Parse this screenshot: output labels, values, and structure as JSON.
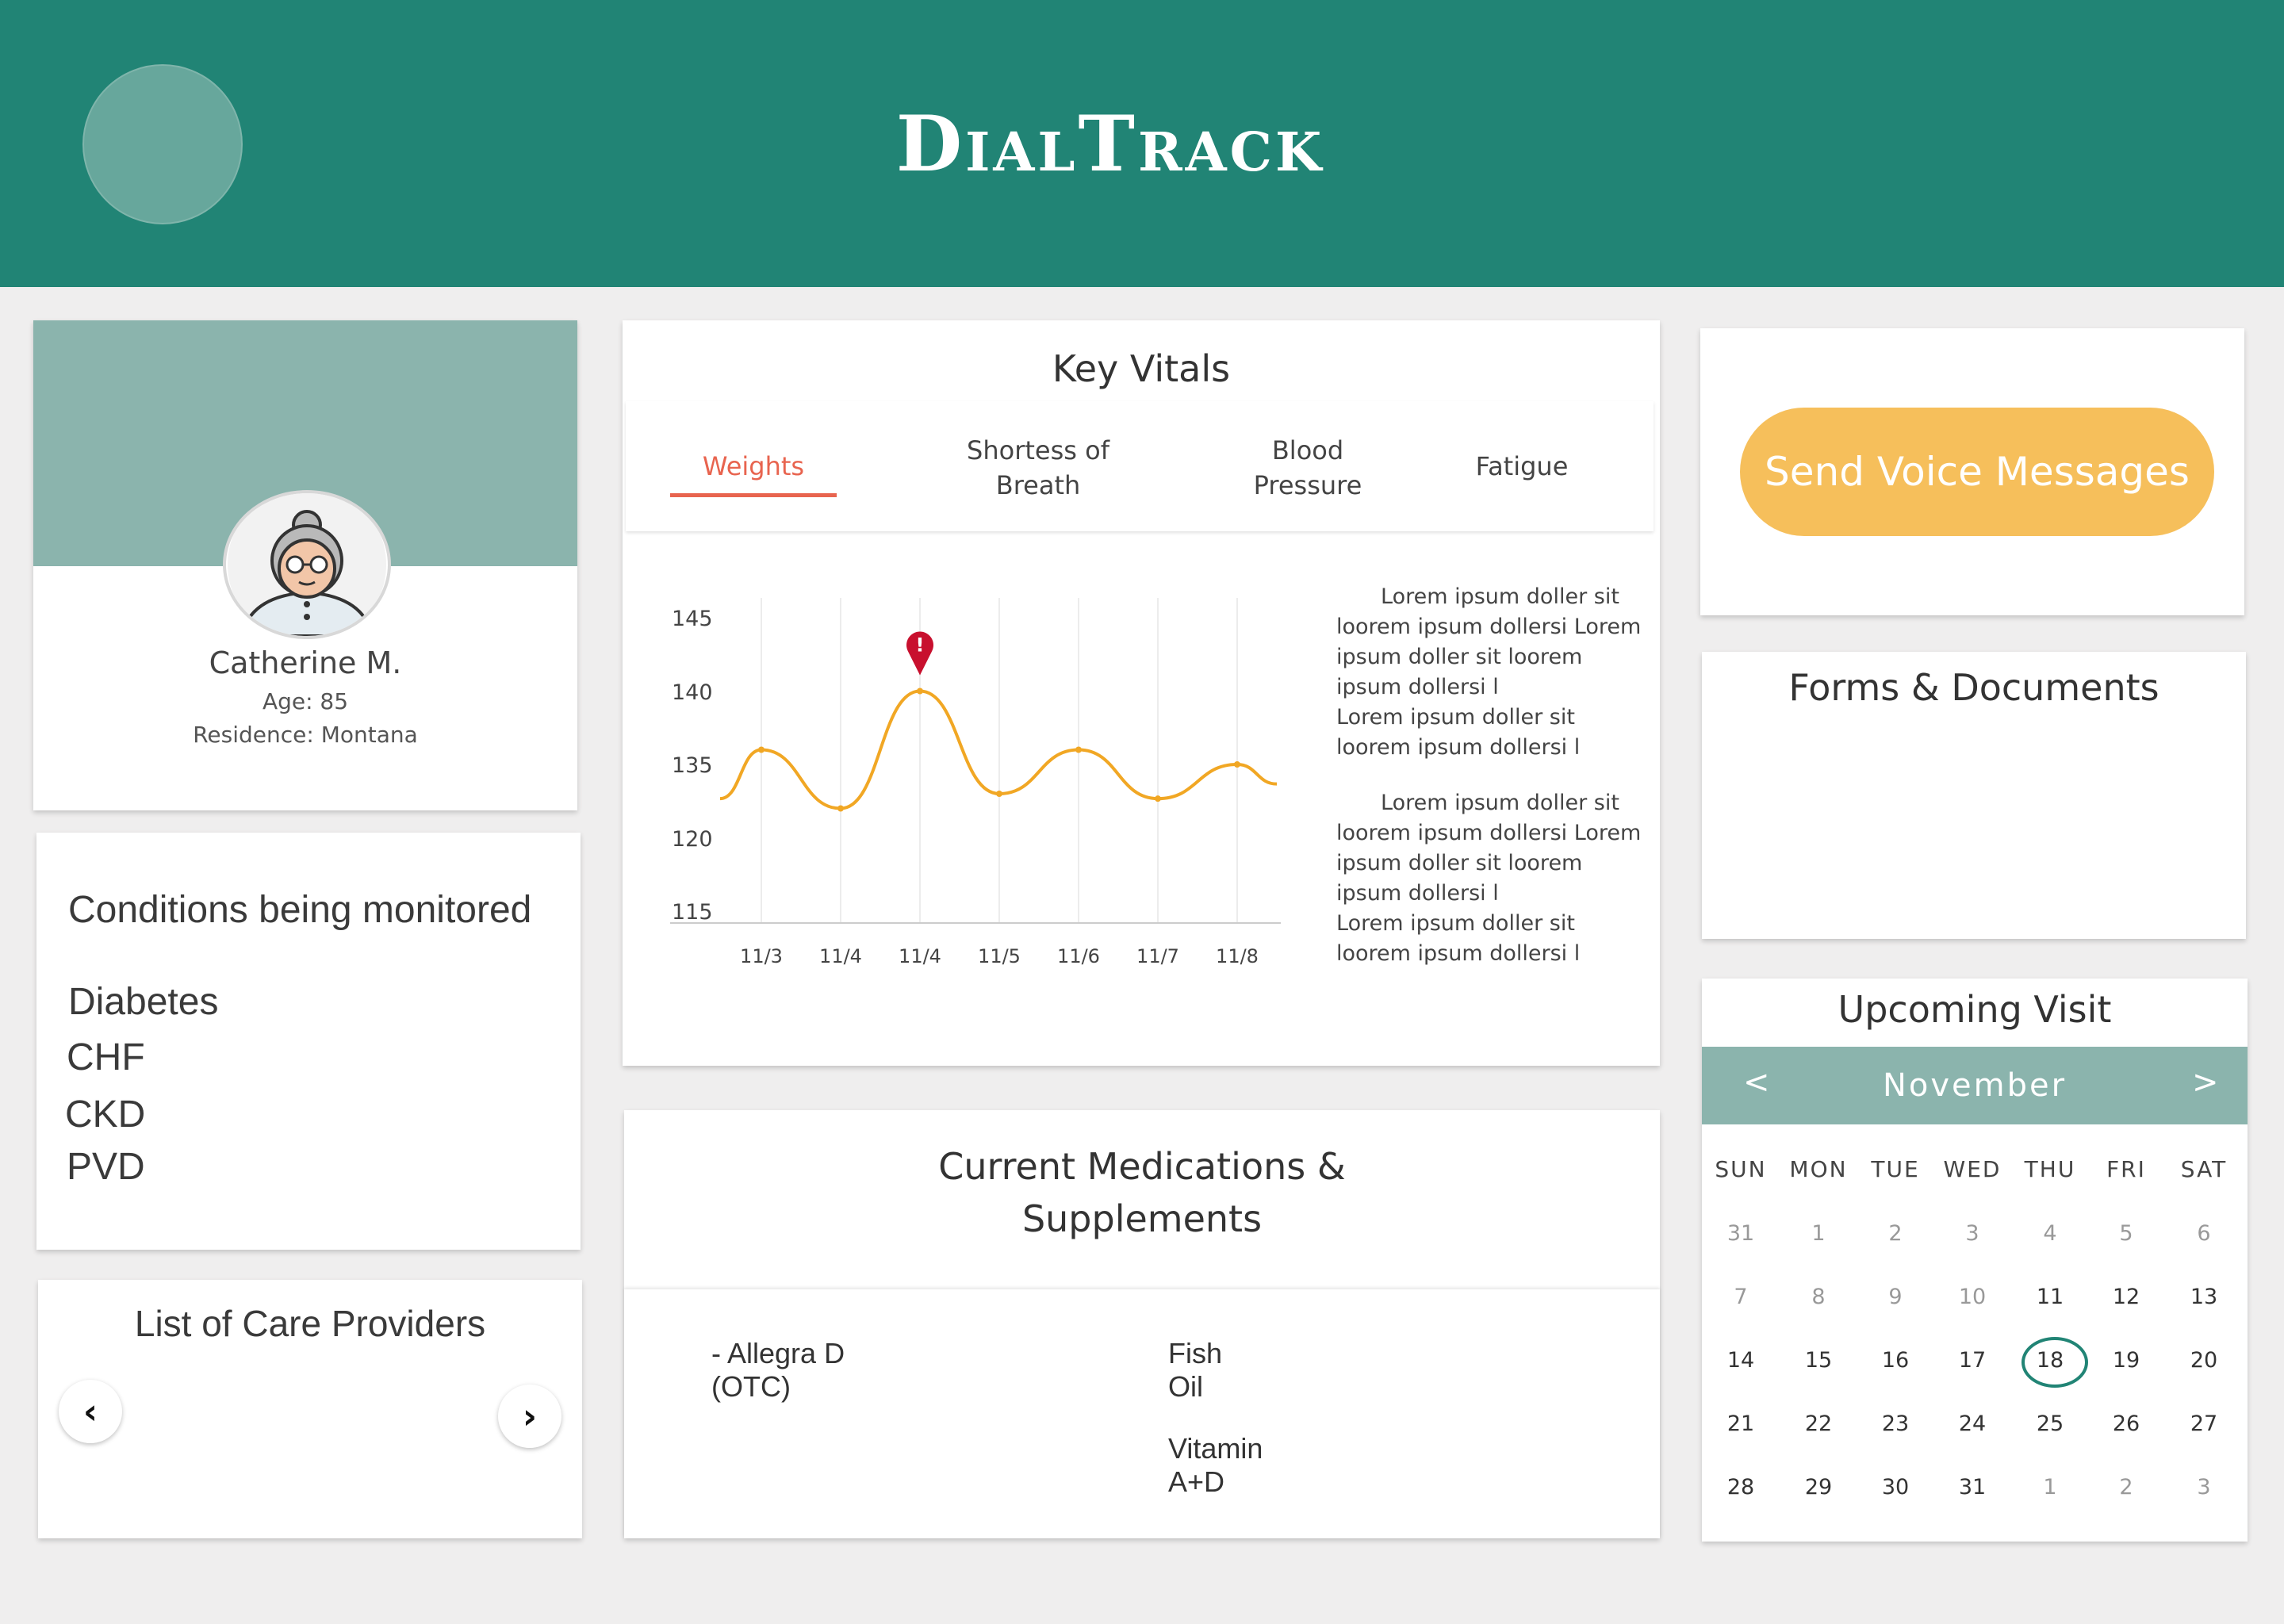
{
  "header": {
    "title": "DialTrack"
  },
  "profile": {
    "name": "Catherine M.",
    "age": "Age: 85",
    "residence": "Residence: Montana"
  },
  "conditions": {
    "heading": "Conditions being monitored",
    "items": [
      "Diabetes",
      "CHF",
      "CKD",
      "PVD"
    ]
  },
  "providers": {
    "heading": "List of Care Providers"
  },
  "vitals": {
    "heading": "Key Vitals",
    "tabs": [
      {
        "label": "Weights"
      },
      {
        "label": "Shortess of\nBreath"
      },
      {
        "label": "Blood\nPressure"
      },
      {
        "label": "Fatigue"
      }
    ],
    "notes": [
      "Lorem ipsum doller sit loorem ipsum dollersi Lorem ipsum doller sit loorem ipsum dollersi l\nLorem ipsum doller sit loorem ipsum dollersi l",
      "Lorem ipsum doller sit loorem ipsum dollersi Lorem ipsum doller sit loorem ipsum dollersi l\nLorem ipsum doller sit loorem ipsum dollersi l"
    ]
  },
  "chart_data": {
    "type": "line",
    "title": "",
    "xlabel": "",
    "ylabel": "",
    "x": [
      "11/3",
      "11/4",
      "11/4",
      "11/5",
      "11/6",
      "11/7",
      "11/8"
    ],
    "y_tick_labels": [
      "145",
      "140",
      "135",
      "120",
      "115"
    ],
    "series": [
      {
        "values": [
          136,
          130.5,
          140,
          132,
          136,
          131.5,
          135
        ]
      }
    ],
    "alert_marker": {
      "index": 2,
      "label": "!"
    },
    "colors": {
      "line": "#f1a724",
      "alert": "#c8102e"
    },
    "grid": "vertical"
  },
  "medications": {
    "heading_line1": "Current Medications &",
    "heading_line2": "Supplements",
    "items": [
      "- Allegra D\n(OTC)",
      "Fish\nOil",
      "Vitamin\nA+D"
    ]
  },
  "voice": {
    "button_label": "Send Voice Messages"
  },
  "forms": {
    "heading": "Forms & Documents"
  },
  "visit": {
    "heading": "Upcoming Visit",
    "month": "November",
    "prev": "<",
    "next": ">",
    "days_of_week": [
      "SUN",
      "MON",
      "TUE",
      "WED",
      "THU",
      "FRI",
      "SAT"
    ],
    "weeks": [
      [
        "31",
        "1",
        "2",
        "3",
        "4",
        "5",
        "6"
      ],
      [
        "7",
        "8",
        "9",
        "10",
        "11",
        "12",
        "13"
      ],
      [
        "14",
        "15",
        "16",
        "17",
        "18",
        "19",
        "20"
      ],
      [
        "21",
        "22",
        "23",
        "24",
        "25",
        "26",
        "27"
      ],
      [
        "28",
        "29",
        "30",
        "31",
        "1",
        "2",
        "3"
      ]
    ],
    "selected": "18",
    "colors": {
      "accent": "#218475",
      "header": "#8bb4ad",
      "voice_button": "#f6bf5b"
    }
  }
}
